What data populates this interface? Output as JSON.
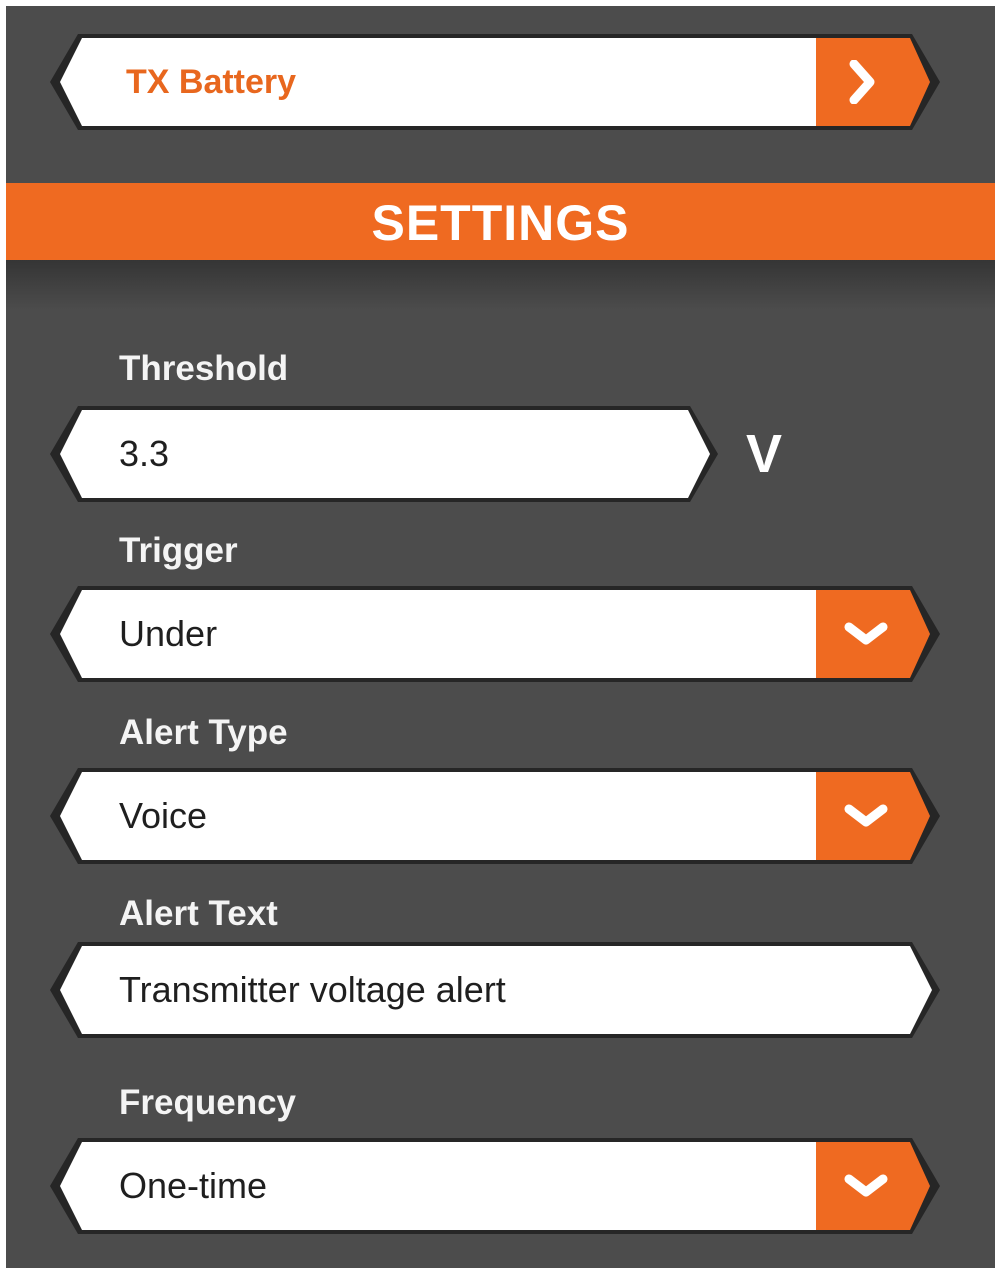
{
  "nav": {
    "title": "TX Battery",
    "arrow_icon": "chevron-right-icon"
  },
  "settings_header": "SETTINGS",
  "threshold": {
    "label": "Threshold",
    "value": "3.3",
    "unit": "V"
  },
  "trigger": {
    "label": "Trigger",
    "value": "Under",
    "icon": "chevron-down-icon"
  },
  "alert_type": {
    "label": "Alert Type",
    "value": "Voice",
    "icon": "chevron-down-icon"
  },
  "alert_text": {
    "label": "Alert Text",
    "value": "Transmitter voltage alert"
  },
  "frequency": {
    "label": "Frequency",
    "value": "One-time",
    "icon": "chevron-down-icon"
  },
  "colors": {
    "accent": "#ef6a21",
    "background": "#4c4c4c",
    "field": "#ffffff",
    "nav_text": "#e8671e"
  }
}
